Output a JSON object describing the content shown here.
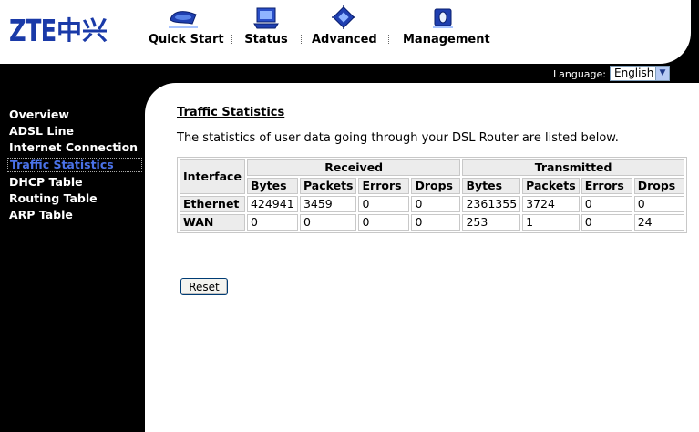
{
  "logo": {
    "latin": "ZTE",
    "cjk": "中兴"
  },
  "nav": [
    {
      "label": "Quick Start"
    },
    {
      "label": "Status"
    },
    {
      "label": "Advanced"
    },
    {
      "label": "Management"
    }
  ],
  "language": {
    "label": "Language:",
    "selected": "English"
  },
  "sidebar": {
    "items": [
      {
        "label": "Overview"
      },
      {
        "label": "ADSL Line"
      },
      {
        "label": "Internet Connection"
      },
      {
        "label": "Traffic Statistics",
        "active": true
      },
      {
        "label": "DHCP Table"
      },
      {
        "label": "Routing Table"
      },
      {
        "label": "ARP Table"
      }
    ]
  },
  "main": {
    "title": "Traffic Statistics",
    "description": "The statistics of user data going through your DSL Router are listed below.",
    "table": {
      "interface_header": "Interface",
      "received_header": "Received",
      "transmitted_header": "Transmitted",
      "sub_headers": [
        "Bytes",
        "Packets",
        "Errors",
        "Drops",
        "Bytes",
        "Packets",
        "Errors",
        "Drops"
      ],
      "rows": [
        {
          "interface": "Ethernet",
          "cells": [
            "424941",
            "3459",
            "0",
            "0",
            "2361355",
            "3724",
            "0",
            "0"
          ]
        },
        {
          "interface": "WAN",
          "cells": [
            "0",
            "0",
            "0",
            "0",
            "253",
            "1",
            "0",
            "24"
          ]
        }
      ]
    },
    "reset_label": "Reset"
  },
  "colors": {
    "logo_blue": "#1a3aa8",
    "active_link": "#4a72e8",
    "header_cell": "#ececec"
  }
}
